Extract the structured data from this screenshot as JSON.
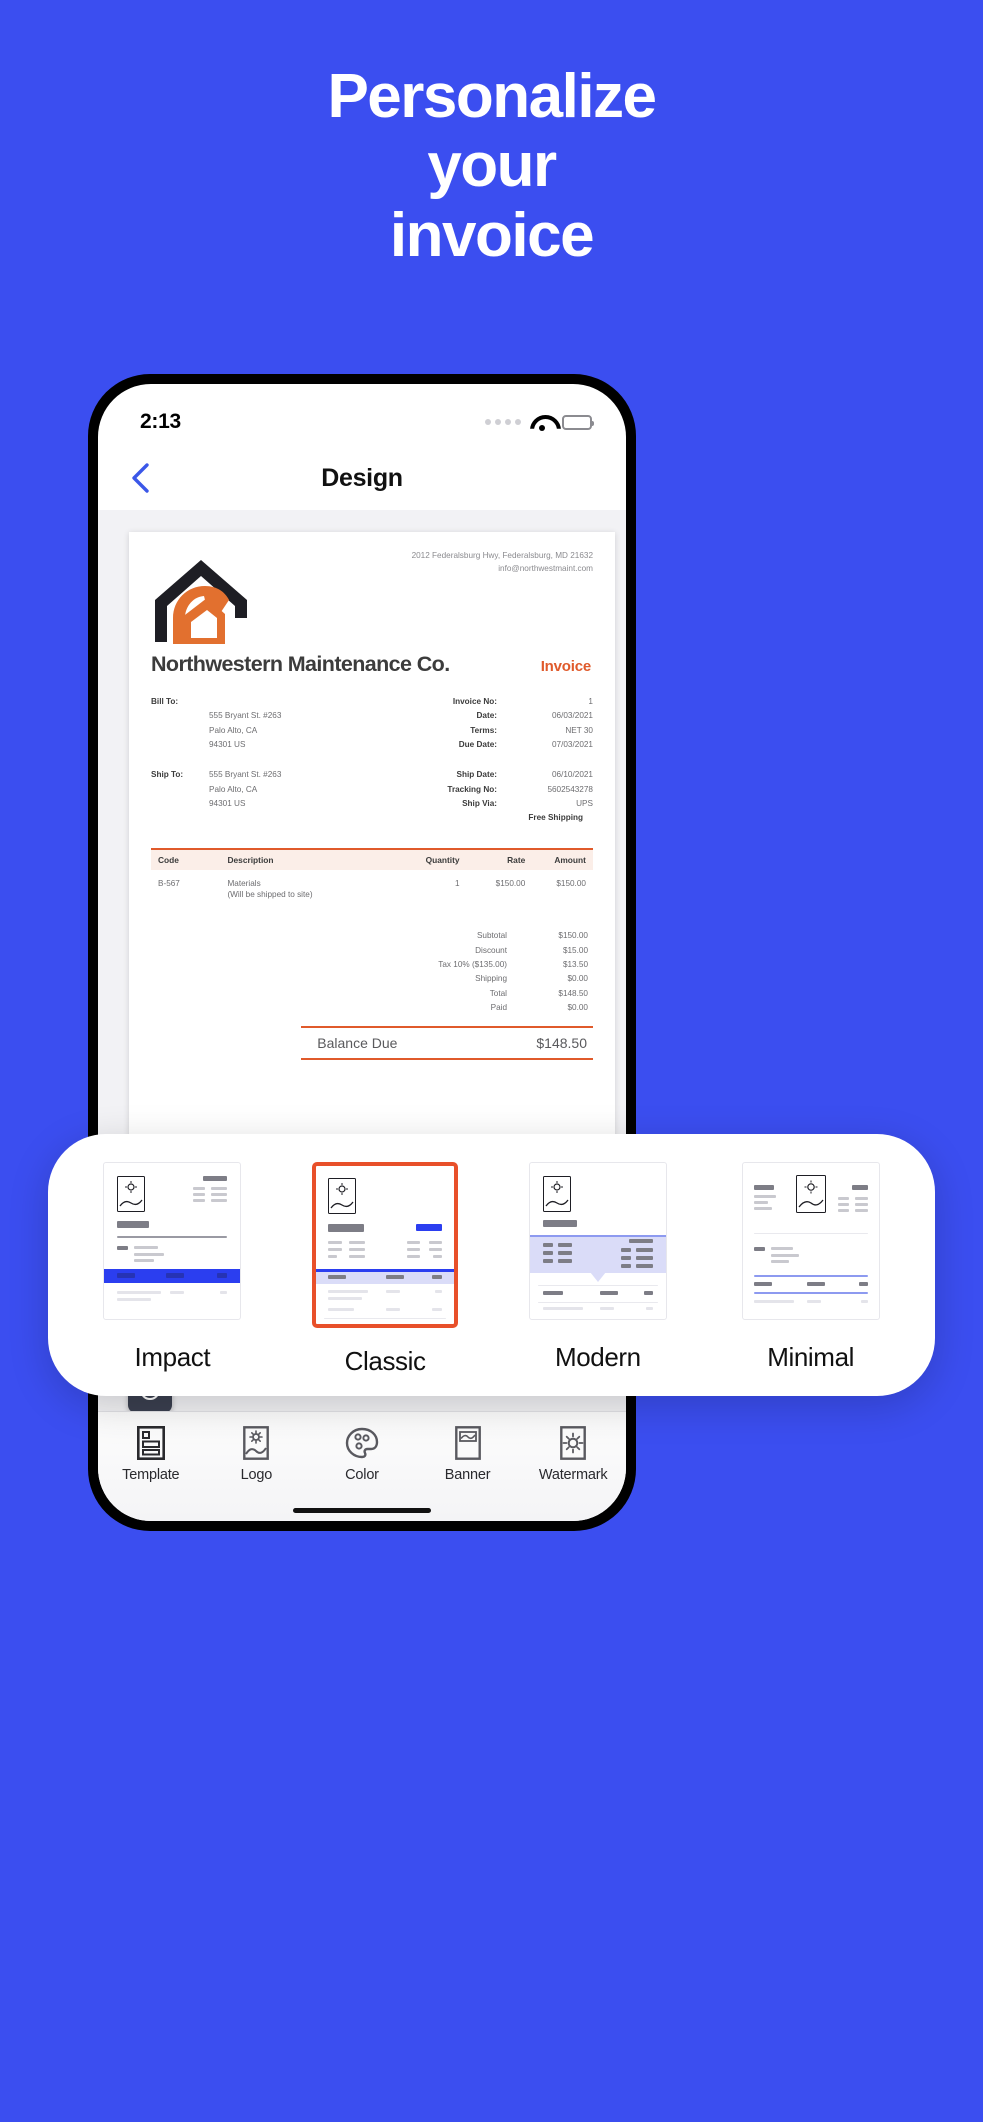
{
  "promo": {
    "headline_lines": [
      "Personalize",
      "your",
      "invoice"
    ],
    "background_color": "#3b4ef0"
  },
  "phone": {
    "status": {
      "time": "2:13",
      "wifi_icon": "wifi-icon",
      "battery_icon": "battery-icon",
      "signal_icon": "signal-dots-icon"
    },
    "nav": {
      "title": "Design",
      "back_icon": "chevron-left-icon"
    }
  },
  "invoice": {
    "company_address_line1": "2012 Federalsburg Hwy, Federalsburg, MD 21632",
    "company_email": "info@northwestmaint.com",
    "company_name": "Northwestern Maintenance Co.",
    "doc_label": "Invoice",
    "logo_icon": "house-hammer-logo-icon",
    "bill_to_label": "Bill To:",
    "bill_to_lines": [
      "555 Bryant St. #263",
      "Palo Alto, CA",
      "94301 US"
    ],
    "ship_to_label": "Ship To:",
    "ship_to_lines": [
      "555 Bryant St. #263",
      "Palo Alto, CA",
      "94301 US"
    ],
    "details": [
      {
        "label": "Invoice No:",
        "value": "1"
      },
      {
        "label": "Date:",
        "value": "06/03/2021"
      },
      {
        "label": "Terms:",
        "value": "NET 30"
      },
      {
        "label": "Due Date:",
        "value": "07/03/2021"
      }
    ],
    "shipping_details": [
      {
        "label": "Ship Date:",
        "value": "06/10/2021"
      },
      {
        "label": "Tracking No:",
        "value": "5602543278"
      },
      {
        "label": "Ship Via:",
        "value": "UPS"
      }
    ],
    "shipping_note": "Free Shipping",
    "table_headers": [
      "Code",
      "Description",
      "Quantity",
      "Rate",
      "Amount"
    ],
    "line_items": [
      {
        "code": "B-567",
        "description": "Materials",
        "description_sub": "(Will be shipped to site)",
        "quantity": "1",
        "rate": "$150.00",
        "amount": "$150.00"
      }
    ],
    "totals": [
      {
        "label": "Subtotal",
        "value": "$150.00"
      },
      {
        "label": "Discount",
        "value": "$15.00"
      },
      {
        "label": "Tax 10% ($135.00)",
        "value": "$13.50"
      },
      {
        "label": "Shipping",
        "value": "$0.00"
      },
      {
        "label": "Total",
        "value": "$148.50"
      },
      {
        "label": "Paid",
        "value": "$0.00"
      }
    ],
    "balance_label": "Balance Due",
    "balance_value": "$148.50",
    "accent_color": "#e05a2b",
    "add_button_icon": "plus-circle-icon"
  },
  "template_picker": {
    "items": [
      {
        "label": "Impact",
        "selected": false
      },
      {
        "label": "Classic",
        "selected": true
      },
      {
        "label": "Modern",
        "selected": false
      },
      {
        "label": "Minimal",
        "selected": false
      }
    ],
    "selected_border_color": "#e8502a"
  },
  "tabbar": {
    "items": [
      {
        "label": "Template",
        "icon": "template-layout-icon",
        "active": true
      },
      {
        "label": "Logo",
        "icon": "image-photo-icon",
        "active": false
      },
      {
        "label": "Color",
        "icon": "palette-icon",
        "active": false
      },
      {
        "label": "Banner",
        "icon": "banner-icon",
        "active": false
      },
      {
        "label": "Watermark",
        "icon": "sun-watermark-icon",
        "active": false
      }
    ]
  }
}
